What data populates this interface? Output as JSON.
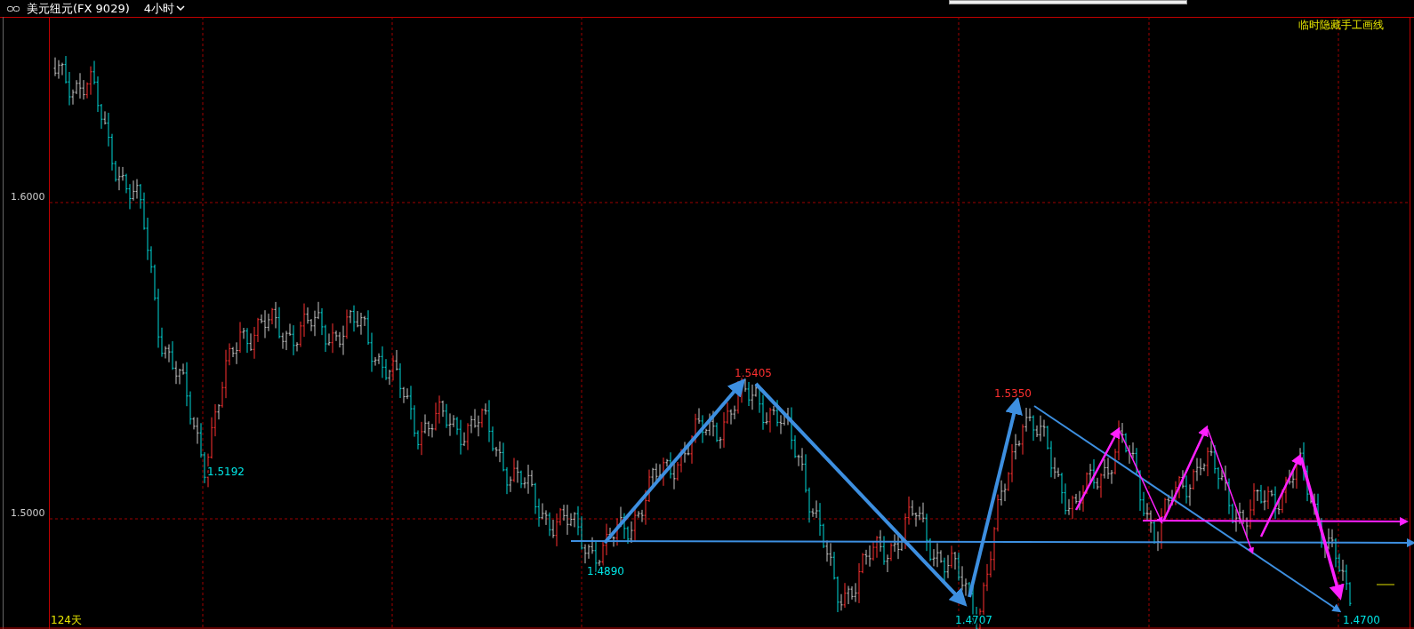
{
  "header": {
    "symbol": "美元纽元(FX 9029)",
    "period": "4小时"
  },
  "chart": {
    "y_axis_labels": [
      "1.6000",
      "1.5000"
    ],
    "toggle_label": "临时隐藏手工画线",
    "bar_count": "124天",
    "price_marks": [
      {
        "text": "1.5192",
        "color": "#00e5e5"
      },
      {
        "text": "1.5405",
        "color": "#ff3030"
      },
      {
        "text": "1.4890",
        "color": "#00e5e5"
      },
      {
        "text": "1.5350",
        "color": "#ff3030"
      },
      {
        "text": "1.4707",
        "color": "#00e5e5"
      },
      {
        "text": "1.4700",
        "color": "#00e5e5"
      }
    ]
  }
}
